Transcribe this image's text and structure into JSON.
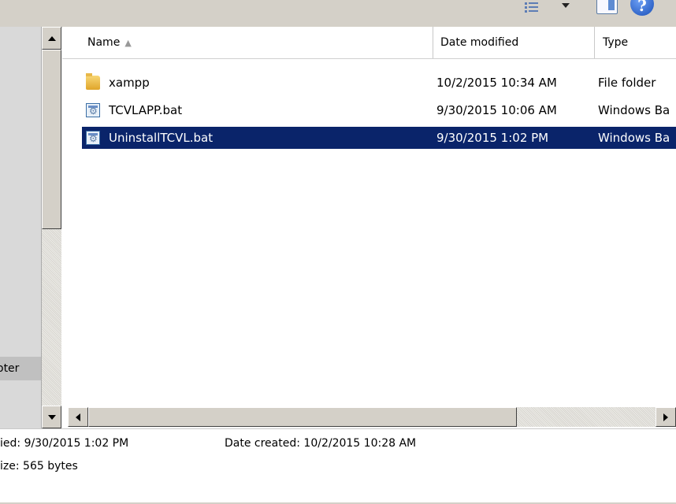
{
  "toolbar": {
    "icons": [
      "view-menu-icon",
      "dropdown-arrow-icon",
      "preview-pane-icon",
      "help-icon"
    ],
    "help_glyph": "?"
  },
  "left_pane": {
    "visible_label": "oter"
  },
  "columns": {
    "name": "Name",
    "date": "Date modified",
    "type": "Type"
  },
  "files": [
    {
      "name": "xampp",
      "date": "10/2/2015 10:34 AM",
      "type": "File folder",
      "icon": "folder-icon",
      "selected": false
    },
    {
      "name": "TCVLAPP.bat",
      "date": "9/30/2015 10:06 AM",
      "type": "Windows Ba",
      "icon": "batch-file-icon",
      "selected": false
    },
    {
      "name": "UninstallTCVL.bat",
      "date": "9/30/2015 1:02 PM",
      "type": "Windows Ba",
      "icon": "batch-file-icon",
      "selected": true
    }
  ],
  "details": {
    "modified_label": "ied:",
    "modified_value": "9/30/2015 1:02 PM",
    "created_label": "Date created:",
    "created_value": "10/2/2015 10:28 AM",
    "size_label": "ize:",
    "size_value": "565 bytes"
  },
  "colors": {
    "selection": "#0a246a",
    "chrome": "#d4d0c8"
  }
}
